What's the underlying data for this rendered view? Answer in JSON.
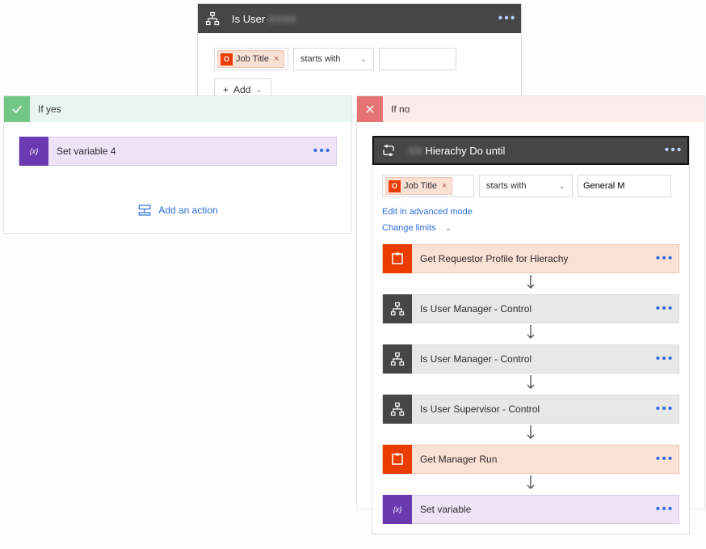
{
  "condition": {
    "title": "Is User",
    "chip_label": "Job Title",
    "operator": "starts with",
    "add_label": "Add"
  },
  "branches": {
    "yes_label": "If yes",
    "no_label": "If no"
  },
  "yes_branch": {
    "action_title": "Set variable 4",
    "add_action_label": "Add an action"
  },
  "no_branch": {
    "do_until_title": "Hierachy Do until",
    "chip_label": "Job Title",
    "operator": "starts with",
    "value": "General M",
    "advanced_link": "Edit in advanced mode",
    "limits_link": "Change limits",
    "steps": [
      {
        "kind": "orange",
        "title": "Get Requestor Profile for Hierachy"
      },
      {
        "kind": "dark",
        "title": "Is User        Manager - Control"
      },
      {
        "kind": "dark",
        "title": "Is User Manager - Control"
      },
      {
        "kind": "dark",
        "title": "Is User Supervisor - Control"
      },
      {
        "kind": "orange",
        "title": "Get Manager      Run"
      },
      {
        "kind": "purple",
        "title": "Set variable"
      }
    ]
  }
}
